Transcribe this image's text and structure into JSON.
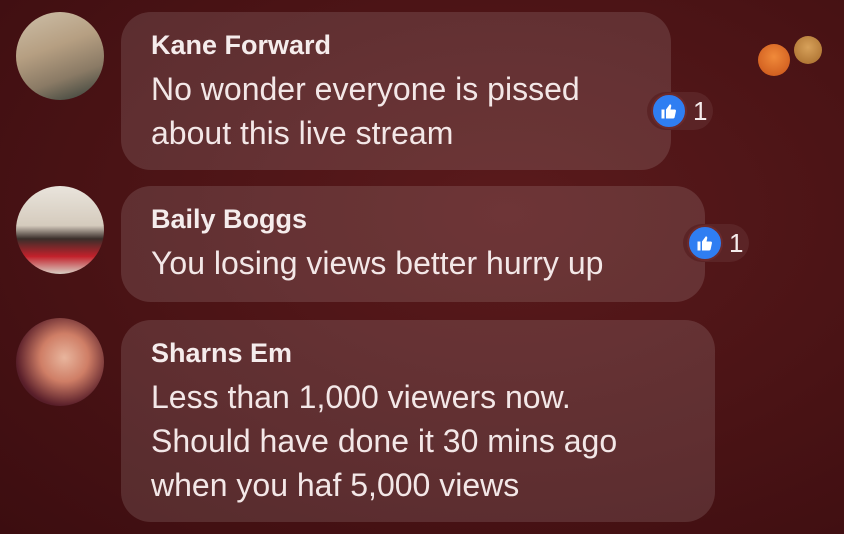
{
  "colors": {
    "background": "#4a1315",
    "bubble": "rgba(255,255,255,0.12)",
    "like": "#2f7ef2"
  },
  "top_reactions": [
    "angry-face-icon",
    "sad-face-icon"
  ],
  "comments": [
    {
      "author": "Kane Forward",
      "text": "No wonder everyone is pissed\nabout this live stream",
      "likes": "1",
      "reaction_icon": "thumbs-up-icon"
    },
    {
      "author": "Baily Boggs",
      "text": "You losing views better hurry up",
      "likes": "1",
      "reaction_icon": "thumbs-up-icon"
    },
    {
      "author": "Sharns Em",
      "text": "Less than 1,000 viewers now.\nShould have done it 30 mins ago\nwhen you haf 5,000 views"
    }
  ]
}
